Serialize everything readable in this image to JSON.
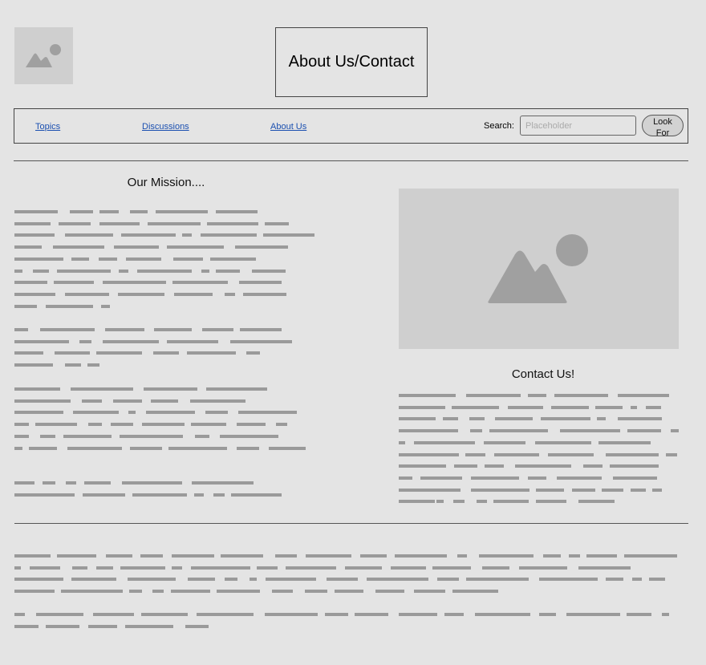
{
  "header": {
    "title": "About Us/Contact"
  },
  "nav": {
    "items": [
      {
        "label": "Topics"
      },
      {
        "label": "Discussions"
      },
      {
        "label": "About Us"
      }
    ],
    "search_label": "Search:",
    "search_placeholder": "Placeholder",
    "search_button": "Look For"
  },
  "mission": {
    "heading": "Our Mission...."
  },
  "contact": {
    "heading": "Contact Us!"
  },
  "colors": {
    "background": "#e4e4e4",
    "placeholder_image": "#cfcfcf",
    "placeholder_glyph": "#a0a0a0",
    "placeholder_text": "#9a9a9a",
    "link": "#1a4fb0"
  },
  "icons": [
    "image-placeholder-icon"
  ]
}
